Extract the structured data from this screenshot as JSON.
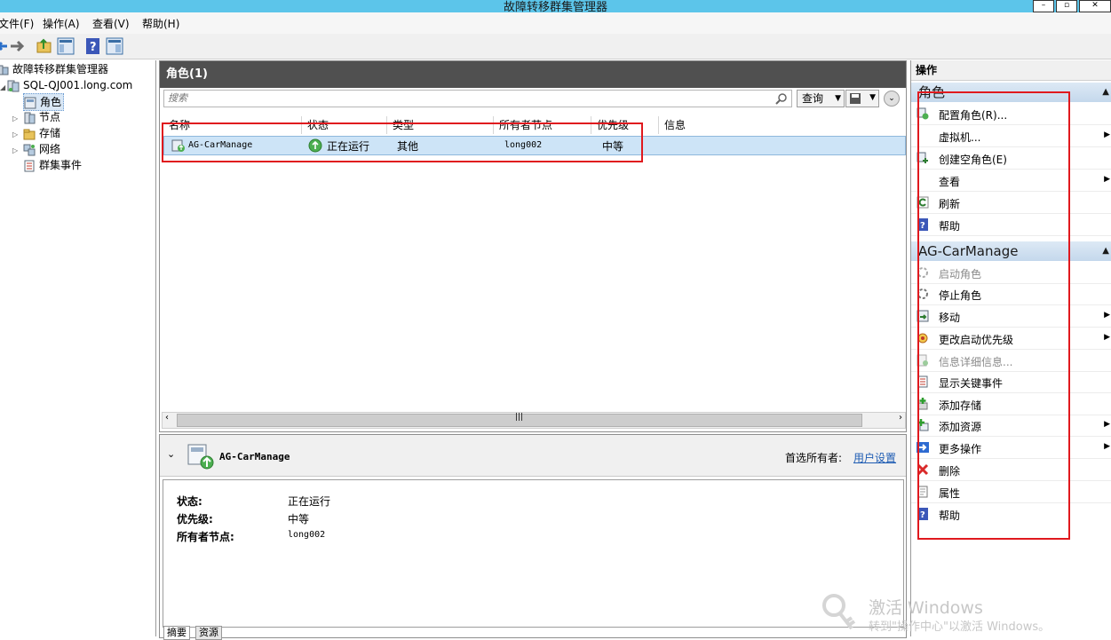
{
  "window": {
    "title": "故障转移群集管理器"
  },
  "menu": [
    "文件(F)",
    "操作(A)",
    "查看(V)",
    "帮助(H)"
  ],
  "tree": {
    "root": "故障转移群集管理器",
    "cluster": "SQL-QJ001.long.com",
    "items": [
      "角色",
      "节点",
      "存储",
      "网络",
      "群集事件"
    ]
  },
  "roles": {
    "header": "角色(1)",
    "search_placeholder": "搜索",
    "query_button": "查询",
    "columns": [
      "名称",
      "状态",
      "类型",
      "所有者节点",
      "优先级",
      "信息"
    ],
    "rows": [
      {
        "name": "AG-CarManage",
        "status": "正在运行",
        "type": "其他",
        "owner": "long002",
        "priority": "中等",
        "info": ""
      }
    ]
  },
  "detail": {
    "title": "AG-CarManage",
    "preferred_owner_label": "首选所有者:",
    "user_settings_link": "用户设置",
    "fields": [
      {
        "key": "状态:",
        "value": "正在运行"
      },
      {
        "key": "优先级:",
        "value": "中等"
      },
      {
        "key": "所有者节点:",
        "value": "long002"
      }
    ],
    "tabs": [
      "摘要",
      "资源"
    ]
  },
  "actions": {
    "header": "操作",
    "sections": [
      {
        "title": "角色",
        "items": [
          {
            "label": "配置角色(R)...",
            "icon": "configure-role-icon",
            "submenu": false,
            "enabled": true
          },
          {
            "label": "虚拟机...",
            "icon": "",
            "submenu": true,
            "enabled": true
          },
          {
            "label": "创建空角色(E)",
            "icon": "create-empty-role-icon",
            "submenu": false,
            "enabled": true
          },
          {
            "label": "查看",
            "icon": "",
            "submenu": true,
            "enabled": true
          },
          {
            "label": "刷新",
            "icon": "refresh-icon",
            "submenu": false,
            "enabled": true
          },
          {
            "label": "帮助",
            "icon": "help-icon",
            "submenu": false,
            "enabled": true
          }
        ]
      },
      {
        "title": "AG-CarManage",
        "items": [
          {
            "label": "启动角色",
            "icon": "start-role-icon",
            "submenu": false,
            "enabled": false
          },
          {
            "label": "停止角色",
            "icon": "stop-role-icon",
            "submenu": false,
            "enabled": true
          },
          {
            "label": "移动",
            "icon": "move-icon",
            "submenu": true,
            "enabled": true
          },
          {
            "label": "更改启动优先级",
            "icon": "priority-icon",
            "submenu": true,
            "enabled": true
          },
          {
            "label": "信息详细信息...",
            "icon": "info-details-icon",
            "submenu": false,
            "enabled": false
          },
          {
            "label": "显示关键事件",
            "icon": "critical-events-icon",
            "submenu": false,
            "enabled": true
          },
          {
            "label": "添加存储",
            "icon": "add-storage-icon",
            "submenu": false,
            "enabled": true
          },
          {
            "label": "添加资源",
            "icon": "add-resource-icon",
            "submenu": true,
            "enabled": true
          },
          {
            "label": "更多操作",
            "icon": "more-actions-icon",
            "submenu": true,
            "enabled": true
          },
          {
            "label": "删除",
            "icon": "delete-icon",
            "submenu": false,
            "enabled": true
          },
          {
            "label": "属性",
            "icon": "properties-icon",
            "submenu": false,
            "enabled": true
          },
          {
            "label": "帮助",
            "icon": "help-icon",
            "submenu": false,
            "enabled": true
          }
        ]
      }
    ]
  },
  "watermark": {
    "line1": "激活 Windows",
    "line2": "转到\"操作中心\"以激活 Windows。"
  }
}
